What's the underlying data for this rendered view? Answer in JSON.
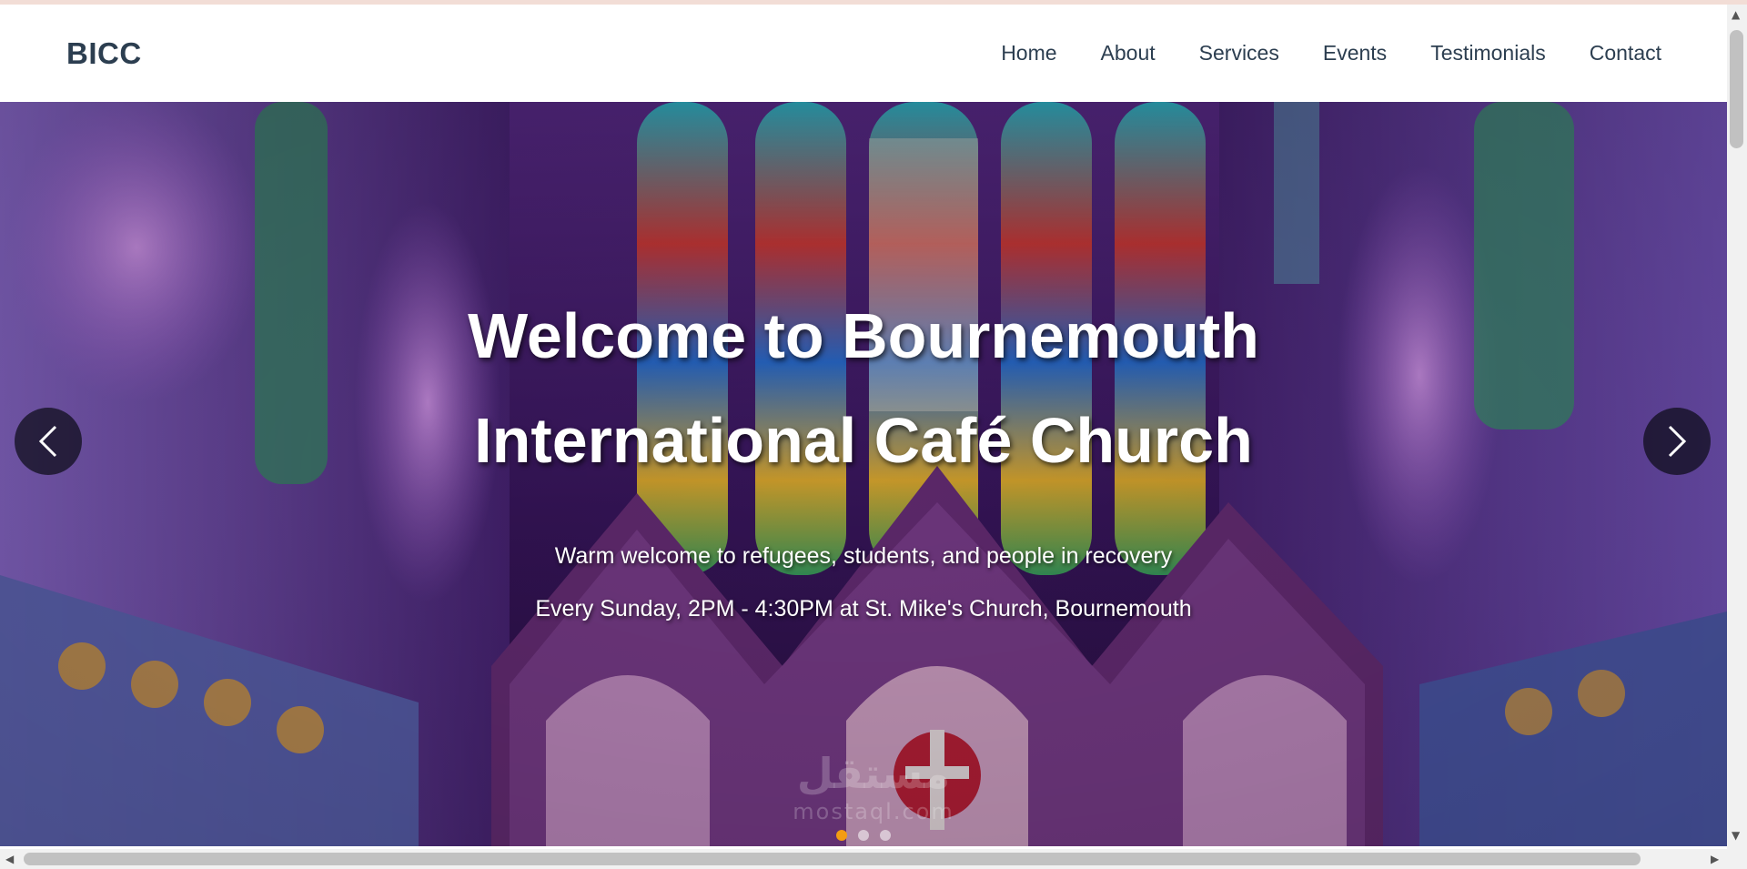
{
  "brand": {
    "name": "BICC"
  },
  "nav": {
    "items": [
      "Home",
      "About",
      "Services",
      "Events",
      "Testimonials",
      "Contact"
    ]
  },
  "hero": {
    "title": "Welcome to Bournemouth International Café Church",
    "subtitle_1": "Warm welcome to refugees, students, and people in recovery",
    "subtitle_2": "Every Sunday, 2PM - 4:30PM at St. Mike's Church, Bournemouth",
    "prev_icon": "chevron-left-icon",
    "next_icon": "chevron-right-icon",
    "slides_total": 3,
    "active_slide": 1
  },
  "watermark": {
    "logo": "مستقل",
    "text": "mostaql.com"
  },
  "colors": {
    "brand_text": "#2c3e50",
    "nav_bg": "#ffffff",
    "active_dot": "#f39c12",
    "hero_purple": "#7b3fc4"
  }
}
